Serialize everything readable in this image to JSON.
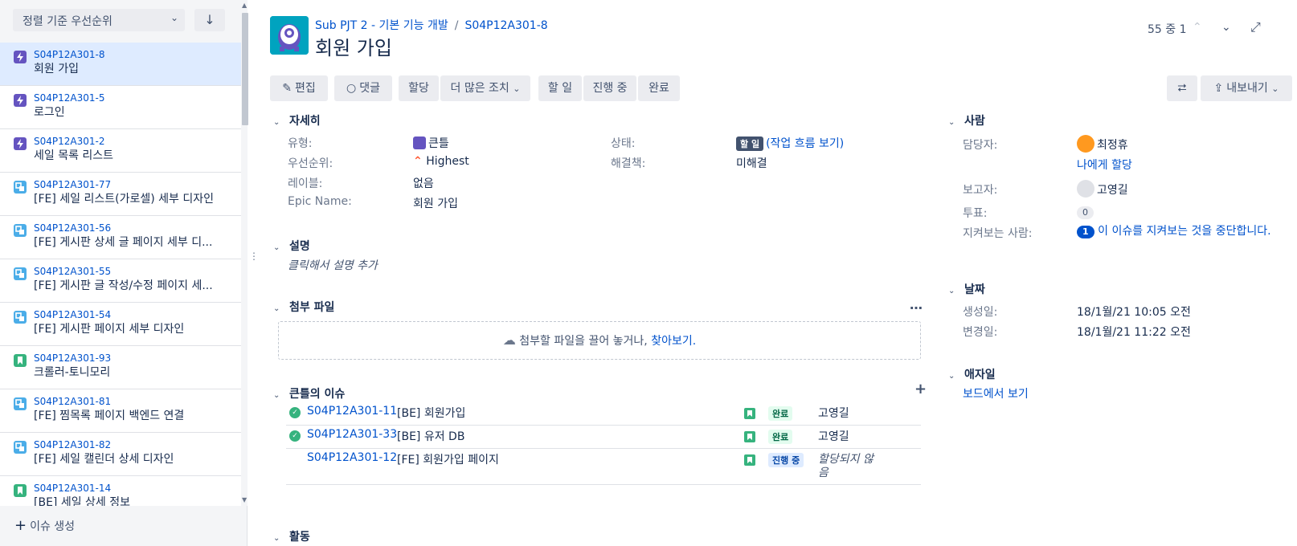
{
  "sidebar": {
    "sort_label": "정렬 기준 우선순위",
    "sort_dir_icon": "arrow-down-icon",
    "items": [
      {
        "key": "S04P12A301-8",
        "summary": "회원 가입",
        "type": "epic",
        "selected": true
      },
      {
        "key": "S04P12A301-5",
        "summary": "로그인",
        "type": "epic"
      },
      {
        "key": "S04P12A301-2",
        "summary": "세일 목록 리스트",
        "type": "epic"
      },
      {
        "key": "S04P12A301-77",
        "summary": "[FE] 세일 리스트(가로셀) 세부 디자인",
        "type": "subtask"
      },
      {
        "key": "S04P12A301-56",
        "summary": "[FE] 게시판 상세 글 페이지 세부 디...",
        "type": "subtask"
      },
      {
        "key": "S04P12A301-55",
        "summary": "[FE] 게시판 글 작성/수정 페이지 세...",
        "type": "subtask"
      },
      {
        "key": "S04P12A301-54",
        "summary": "[FE] 게시판 페이지 세부 디자인",
        "type": "subtask"
      },
      {
        "key": "S04P12A301-93",
        "summary": "크롤러-토니모리",
        "type": "story"
      },
      {
        "key": "S04P12A301-81",
        "summary": "[FE] 찜목록 페이지 백엔드 연결",
        "type": "subtask"
      },
      {
        "key": "S04P12A301-82",
        "summary": "[FE] 세일 캘린더 상세 디자인",
        "type": "subtask"
      },
      {
        "key": "S04P12A301-14",
        "summary": "[BE] 세일 상세 정보",
        "type": "story"
      }
    ],
    "create_label": "이슈 생성"
  },
  "header": {
    "project": "Sub PJT 2 - 기본 기능 개발",
    "issue_key": "S04P12A301-8",
    "title": "회원 가입",
    "pager": "55 중 1"
  },
  "toolbar": {
    "edit": "편집",
    "comment": "댓글",
    "assign": "할당",
    "more": "더 많은 조치",
    "todo": "할 일",
    "in_progress": "진행 중",
    "done": "완료",
    "export": "내보내기"
  },
  "details": {
    "heading": "자세히",
    "type_label": "유형:",
    "type_value": "큰틀",
    "priority_label": "우선순위:",
    "priority_value": "Highest",
    "labels_label": "레이블:",
    "labels_value": "없음",
    "epic_label": "Epic Name:",
    "epic_value": "회원 가입",
    "status_label": "상태:",
    "status_value": "할 일",
    "workflow_link": "(작업 흐름 보기)",
    "resolution_label": "해결책:",
    "resolution_value": "미해결"
  },
  "description": {
    "heading": "설명",
    "placeholder": "클릭해서 설명 추가"
  },
  "attachments": {
    "heading": "첨부 파일",
    "drop_text": "첨부할 파일을 끌어 놓거나,",
    "browse": "찾아보기."
  },
  "children": {
    "heading": "큰틀의 이슈",
    "rows": [
      {
        "key": "S04P12A301-11",
        "summary": "[BE] 회원가입",
        "status": "완료",
        "assignee": "고영길",
        "resolved": true
      },
      {
        "key": "S04P12A301-33",
        "summary": "[BE] 유저 DB",
        "status": "완료",
        "assignee": "고영길",
        "resolved": true
      },
      {
        "key": "S04P12A301-12",
        "summary": "[FE] 회원가입 페이지",
        "status": "진행 중",
        "assignee": "할당되지 않음",
        "resolved": false
      }
    ]
  },
  "activity": {
    "heading": "활동"
  },
  "people": {
    "heading": "사람",
    "assignee_label": "담당자:",
    "assignee_value": "최정휴",
    "assign_to_me": "나에게 할당",
    "reporter_label": "보고자:",
    "reporter_value": "고영길",
    "votes_label": "투표:",
    "votes_value": "0",
    "watchers_label": "지켜보는 사람:",
    "watchers_count": "1",
    "watchers_link": "이 이슈를 지켜보는 것을 중단합니다."
  },
  "dates": {
    "heading": "날짜",
    "created_label": "생성일:",
    "created_value": "18/1월/21 10:05 오전",
    "updated_label": "변경일:",
    "updated_value": "18/1월/21 11:22 오전"
  },
  "agile": {
    "heading": "애자일",
    "board_link": "보드에서 보기"
  }
}
